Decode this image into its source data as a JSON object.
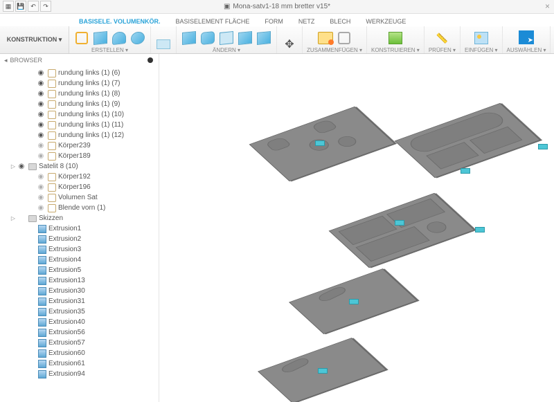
{
  "title": "Mona-satv1-18 mm bretter v15*",
  "qat": [
    "file",
    "save",
    "undo",
    "redo"
  ],
  "tabs": [
    {
      "label": "BASISELE. VOLUMENKÖR.",
      "active": true
    },
    {
      "label": "BASISELEMENT FLÄCHE"
    },
    {
      "label": "FORM"
    },
    {
      "label": "NETZ"
    },
    {
      "label": "BLECH"
    },
    {
      "label": "WERKZEUGE"
    }
  ],
  "ribbon": {
    "konstruktion": "KONSTRUKTION ▾",
    "groups": [
      {
        "label": "ERSTELLEN ▾"
      },
      {
        "label": ""
      },
      {
        "label": "ÄNDERN ▾"
      },
      {
        "label": ""
      },
      {
        "label": "ZUSAMMENFÜGEN ▾"
      },
      {
        "label": "KONSTRUIEREN ▾"
      },
      {
        "label": "PRÜFEN ▾"
      },
      {
        "label": "EINFÜGEN ▾"
      },
      {
        "label": "AUSWÄHLEN ▾"
      }
    ]
  },
  "browser": {
    "title": "BROWSER"
  },
  "tree": [
    {
      "depth": 3,
      "eye": true,
      "kind": "ck",
      "label": "rundung links (1) (6)"
    },
    {
      "depth": 3,
      "eye": true,
      "kind": "ck",
      "label": "rundung links (1) (7)"
    },
    {
      "depth": 3,
      "eye": true,
      "kind": "ck",
      "label": "rundung links (1) (8)"
    },
    {
      "depth": 3,
      "eye": true,
      "kind": "ck",
      "label": "rundung links (1) (9)"
    },
    {
      "depth": 3,
      "eye": true,
      "kind": "ck",
      "label": "rundung links (1) (10)"
    },
    {
      "depth": 3,
      "eye": true,
      "kind": "ck",
      "label": "rundung links (1) (11)"
    },
    {
      "depth": 3,
      "eye": true,
      "kind": "ck",
      "label": "rundung links (1) (12)"
    },
    {
      "depth": 3,
      "eye": false,
      "kind": "ck",
      "label": "Körper239"
    },
    {
      "depth": 3,
      "eye": false,
      "kind": "ck",
      "label": "Körper189"
    },
    {
      "depth": 1,
      "exp": "▷",
      "eye": true,
      "kind": "folder",
      "label": "Satelit 8 (10)"
    },
    {
      "depth": 3,
      "eye": false,
      "kind": "ck",
      "label": "Körper192"
    },
    {
      "depth": 3,
      "eye": false,
      "kind": "ck",
      "label": "Körper196"
    },
    {
      "depth": 3,
      "eye": false,
      "kind": "ck",
      "label": "Volumen Sat"
    },
    {
      "depth": 3,
      "eye": false,
      "kind": "ck",
      "label": "Blende vorn (1)"
    },
    {
      "depth": 1,
      "exp": "▷",
      "kind": "folder",
      "label": "Skizzen"
    },
    {
      "depth": 2,
      "kind": "feat",
      "label": "Extrusion1"
    },
    {
      "depth": 2,
      "kind": "feat",
      "label": "Extrusion2"
    },
    {
      "depth": 2,
      "kind": "feat",
      "label": "Extrusion3"
    },
    {
      "depth": 2,
      "kind": "feat",
      "label": "Extrusion4"
    },
    {
      "depth": 2,
      "kind": "feat",
      "label": "Extrusion5"
    },
    {
      "depth": 2,
      "kind": "feat",
      "label": "Extrusion13"
    },
    {
      "depth": 2,
      "kind": "feat",
      "label": "Extrusion30"
    },
    {
      "depth": 2,
      "kind": "feat",
      "label": "Extrusion31"
    },
    {
      "depth": 2,
      "kind": "feat",
      "label": "Extrusion35"
    },
    {
      "depth": 2,
      "kind": "feat",
      "label": "Extrusion40"
    },
    {
      "depth": 2,
      "kind": "feat",
      "label": "Extrusion56"
    },
    {
      "depth": 2,
      "kind": "feat",
      "label": "Extrusion57"
    },
    {
      "depth": 2,
      "kind": "feat",
      "label": "Extrusion60"
    },
    {
      "depth": 2,
      "kind": "feat",
      "label": "Extrusion61"
    },
    {
      "depth": 2,
      "kind": "feat",
      "label": "Extrusion94"
    }
  ]
}
